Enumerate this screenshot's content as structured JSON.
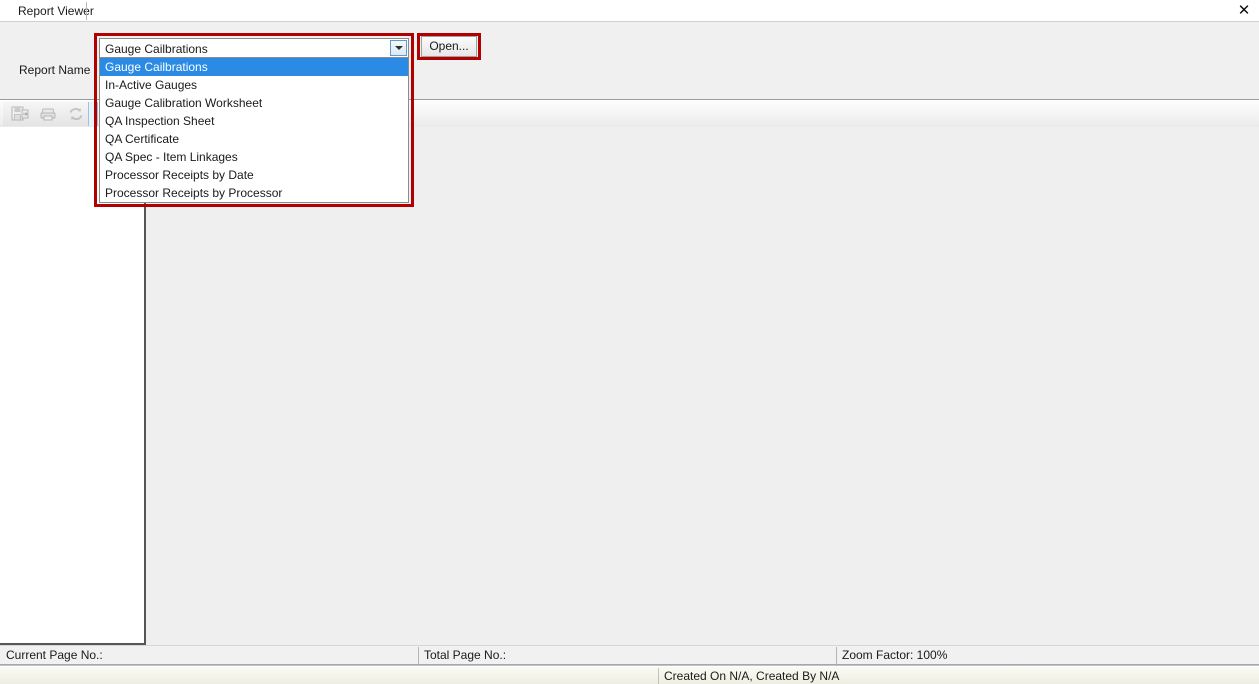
{
  "window": {
    "close_label": "✕"
  },
  "tabs": [
    {
      "label": "Report Viewer"
    }
  ],
  "parameters": {
    "report_name_label": "Report Name",
    "combo": {
      "value": "Gauge Cailbrations",
      "arrow_icon": "chevron-down-icon",
      "options": [
        "Gauge Cailbrations",
        "In-Active Gauges",
        "Gauge Calibration Worksheet",
        "QA Inspection Sheet",
        "QA Certificate",
        "QA Spec - Item Linkages",
        "Processor Receipts by Date",
        "Processor Receipts by Processor"
      ],
      "selected_index": 0
    },
    "open_button_label": "Open..."
  },
  "toolbar": {
    "buttons": [
      {
        "name": "export-icon",
        "enabled": false
      },
      {
        "name": "print-icon",
        "enabled": false
      },
      {
        "name": "refresh-icon",
        "enabled": false
      }
    ]
  },
  "statusbar": {
    "current_page_label": "Current Page No.:",
    "total_page_label": "Total Page No.:",
    "zoom_label": "Zoom Factor: 100%"
  },
  "bottombar": {
    "created_info": "Created On N/A, Created By N/A"
  },
  "colors": {
    "highlight": "#b00000",
    "selection": "#2a8ae4",
    "panel_bg": "#f0f0f0",
    "report_bg": "#efefef"
  }
}
